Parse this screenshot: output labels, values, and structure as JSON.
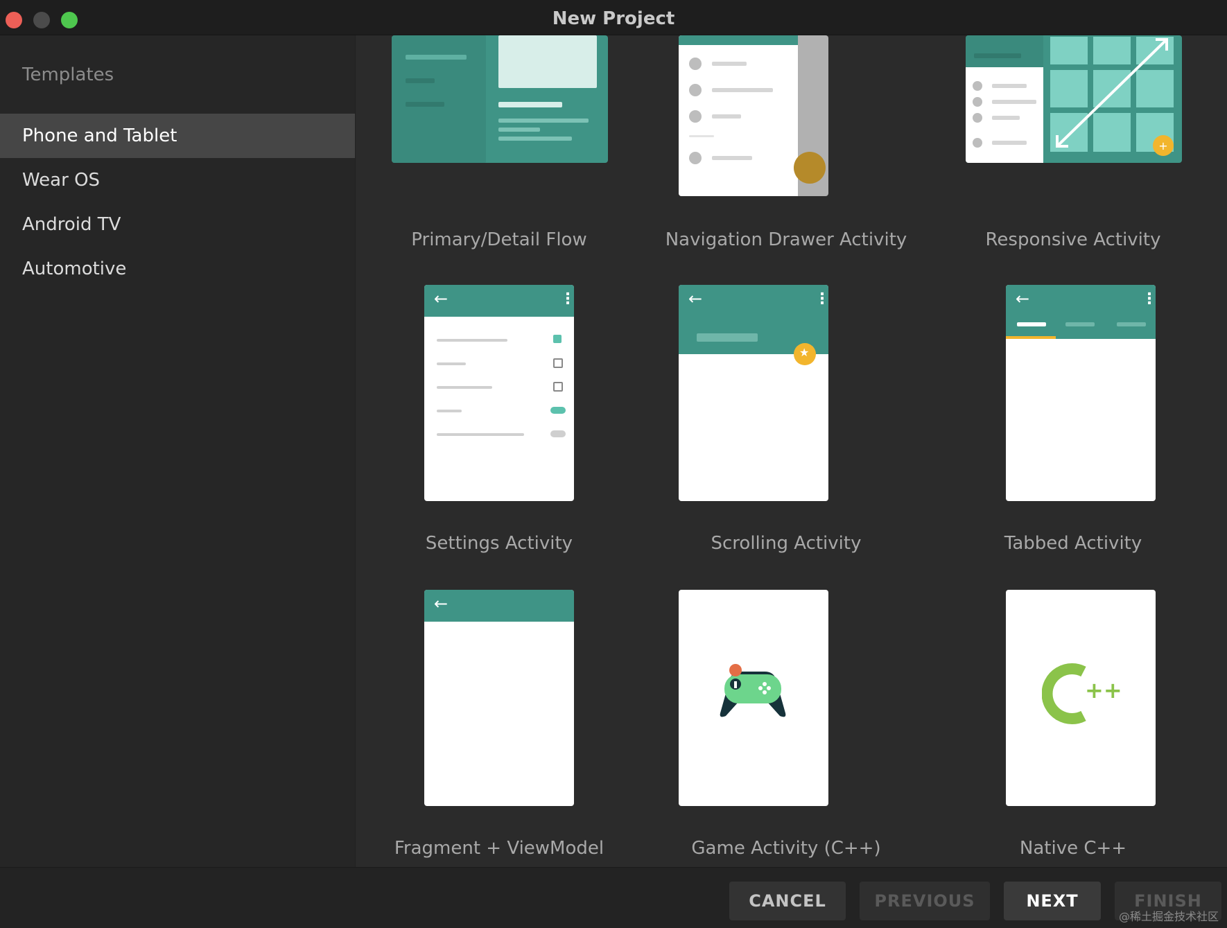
{
  "window": {
    "title": "New Project"
  },
  "sidebar": {
    "header": "Templates",
    "items": [
      {
        "label": "Phone and Tablet",
        "selected": true
      },
      {
        "label": "Wear OS"
      },
      {
        "label": "Android TV"
      },
      {
        "label": "Automotive"
      }
    ]
  },
  "templates": [
    {
      "label": "Primary/Detail Flow"
    },
    {
      "label": "Navigation Drawer Activity"
    },
    {
      "label": "Responsive Activity"
    },
    {
      "label": "Settings Activity"
    },
    {
      "label": "Scrolling Activity"
    },
    {
      "label": "Tabbed Activity"
    },
    {
      "label": "Fragment + ViewModel"
    },
    {
      "label": "Game Activity (C++)"
    },
    {
      "label": "Native C++"
    }
  ],
  "footer": {
    "cancel": "CANCEL",
    "previous": "PREVIOUS",
    "next": "NEXT",
    "finish": "FINISH"
  },
  "watermark": "@稀土掘金技术社区",
  "colors": {
    "teal": "#3f9486",
    "accent_yellow": "#f2b52d",
    "selected_bg": "#464646"
  }
}
